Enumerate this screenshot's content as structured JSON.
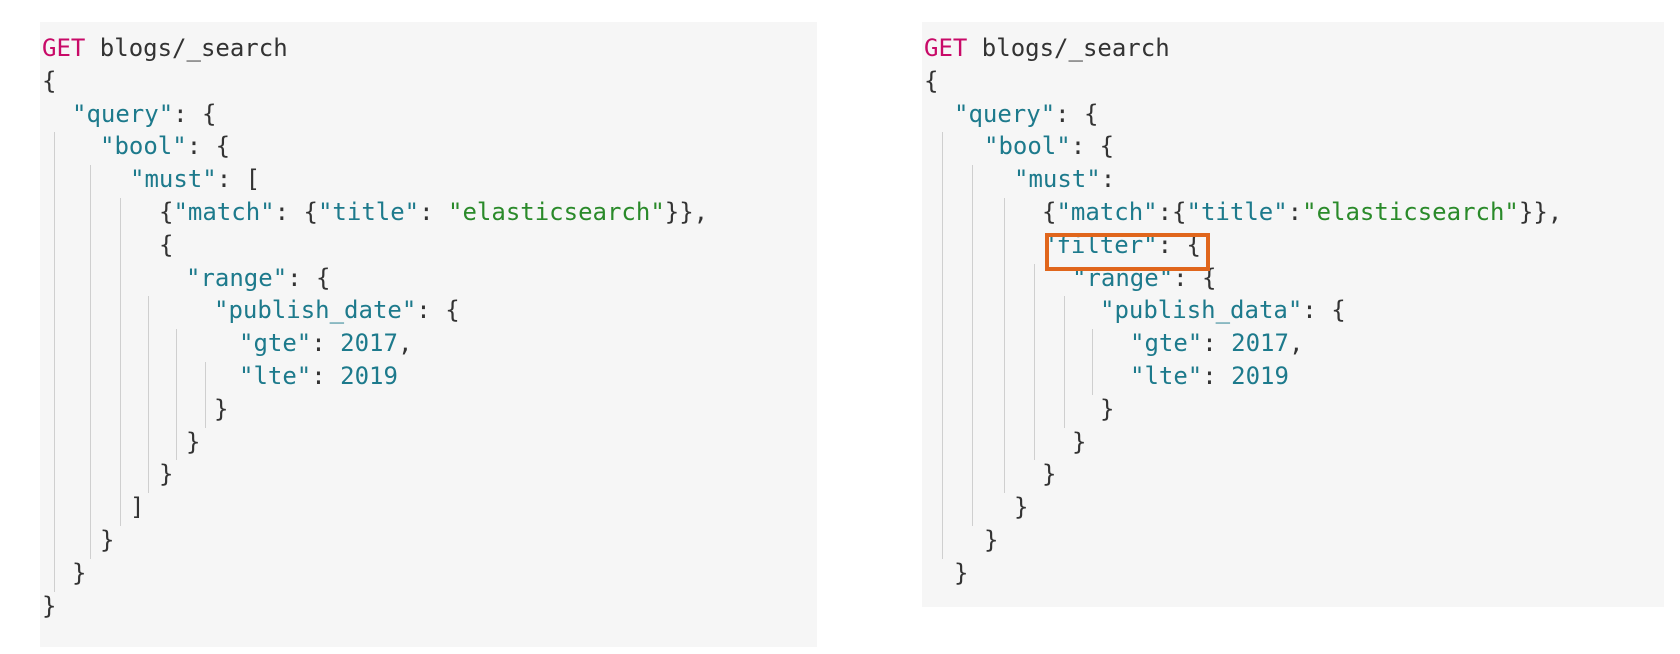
{
  "panels": [
    {
      "name": "query-panel-original",
      "lines": [
        [
          {
            "t": "GET",
            "c": "method"
          },
          {
            "t": " blogs/_search",
            "c": "punct"
          }
        ],
        [
          {
            "t": "{",
            "c": "punct"
          }
        ],
        [
          {
            "t": "\"query\"",
            "c": "key"
          },
          {
            "t": ": {",
            "c": "punct"
          }
        ],
        [
          {
            "t": "\"bool\"",
            "c": "key"
          },
          {
            "t": ": {",
            "c": "punct"
          }
        ],
        [
          {
            "t": "\"must\"",
            "c": "key"
          },
          {
            "t": ": [",
            "c": "punct"
          }
        ],
        [
          {
            "t": "{",
            "c": "punct"
          },
          {
            "t": "\"match\"",
            "c": "key"
          },
          {
            "t": ": {",
            "c": "punct"
          },
          {
            "t": "\"title\"",
            "c": "key"
          },
          {
            "t": ": ",
            "c": "punct"
          },
          {
            "t": "\"elasticsearch\"",
            "c": "str"
          },
          {
            "t": "}},",
            "c": "punct"
          }
        ],
        [
          {
            "t": "{",
            "c": "punct"
          }
        ],
        [
          {
            "t": "\"range\"",
            "c": "key"
          },
          {
            "t": ": {",
            "c": "punct"
          }
        ],
        [
          {
            "t": "\"publish_date\"",
            "c": "key"
          },
          {
            "t": ": {",
            "c": "punct"
          }
        ],
        [
          {
            "t": "\"gte\"",
            "c": "key"
          },
          {
            "t": ": ",
            "c": "punct"
          },
          {
            "t": "2017",
            "c": "num"
          },
          {
            "t": ",",
            "c": "punct"
          }
        ],
        [
          {
            "t": "\"lte\"",
            "c": "key"
          },
          {
            "t": ": ",
            "c": "punct"
          },
          {
            "t": "2019",
            "c": "num"
          }
        ],
        [
          {
            "t": "}",
            "c": "punct"
          }
        ],
        [
          {
            "t": "}",
            "c": "punct"
          }
        ],
        [
          {
            "t": "}",
            "c": "punct"
          }
        ],
        [
          {
            "t": "]",
            "c": "punct"
          }
        ],
        [
          {
            "t": "}",
            "c": "punct"
          }
        ],
        [
          {
            "t": "}",
            "c": "punct"
          }
        ],
        [
          {
            "t": "}",
            "c": "punct"
          }
        ]
      ]
    },
    {
      "name": "query-panel-filter",
      "lines": [
        [
          {
            "t": "GET",
            "c": "method"
          },
          {
            "t": " blogs/_search",
            "c": "punct"
          }
        ],
        [
          {
            "t": "{",
            "c": "punct"
          }
        ],
        [
          {
            "t": "\"query\"",
            "c": "key"
          },
          {
            "t": ": {",
            "c": "punct"
          }
        ],
        [
          {
            "t": "\"bool\"",
            "c": "key"
          },
          {
            "t": ": {",
            "c": "punct"
          }
        ],
        [
          {
            "t": "\"must\"",
            "c": "key"
          },
          {
            "t": ":",
            "c": "punct"
          }
        ],
        [
          {
            "t": "{",
            "c": "punct"
          },
          {
            "t": "\"match\"",
            "c": "key"
          },
          {
            "t": ":{",
            "c": "punct"
          },
          {
            "t": "\"title\"",
            "c": "key"
          },
          {
            "t": ":",
            "c": "punct"
          },
          {
            "t": "\"elasticsearch\"",
            "c": "str"
          },
          {
            "t": "}},",
            "c": "punct"
          }
        ],
        [
          {
            "t": "\"filter\"",
            "c": "key"
          },
          {
            "t": ": {",
            "c": "punct"
          }
        ],
        [
          {
            "t": "\"range\"",
            "c": "key"
          },
          {
            "t": ": {",
            "c": "punct"
          }
        ],
        [
          {
            "t": "\"publish_data\"",
            "c": "key"
          },
          {
            "t": ": {",
            "c": "punct"
          }
        ],
        [
          {
            "t": "\"gte\"",
            "c": "key"
          },
          {
            "t": ": ",
            "c": "punct"
          },
          {
            "t": "2017",
            "c": "num"
          },
          {
            "t": ",",
            "c": "punct"
          }
        ],
        [
          {
            "t": "\"lte\"",
            "c": "key"
          },
          {
            "t": ": ",
            "c": "punct"
          },
          {
            "t": "2019",
            "c": "num"
          }
        ],
        [
          {
            "t": "}",
            "c": "punct"
          }
        ],
        [
          {
            "t": "}",
            "c": "punct"
          }
        ],
        [
          {
            "t": "}",
            "c": "punct"
          }
        ],
        [
          {
            "t": "}",
            "c": "punct"
          }
        ],
        [
          {
            "t": "}",
            "c": "punct"
          }
        ],
        [
          {
            "t": "}",
            "c": "punct"
          }
        ]
      ]
    }
  ],
  "highlight": {
    "label": "filter-clause-highlight",
    "color": "#e0661c"
  },
  "colors": {
    "background": "#f6f6f6",
    "method": "#c80a68",
    "key": "#1d7a8c",
    "string": "#2a8a2a",
    "number": "#1d7a8c",
    "punctuation": "#333333"
  }
}
